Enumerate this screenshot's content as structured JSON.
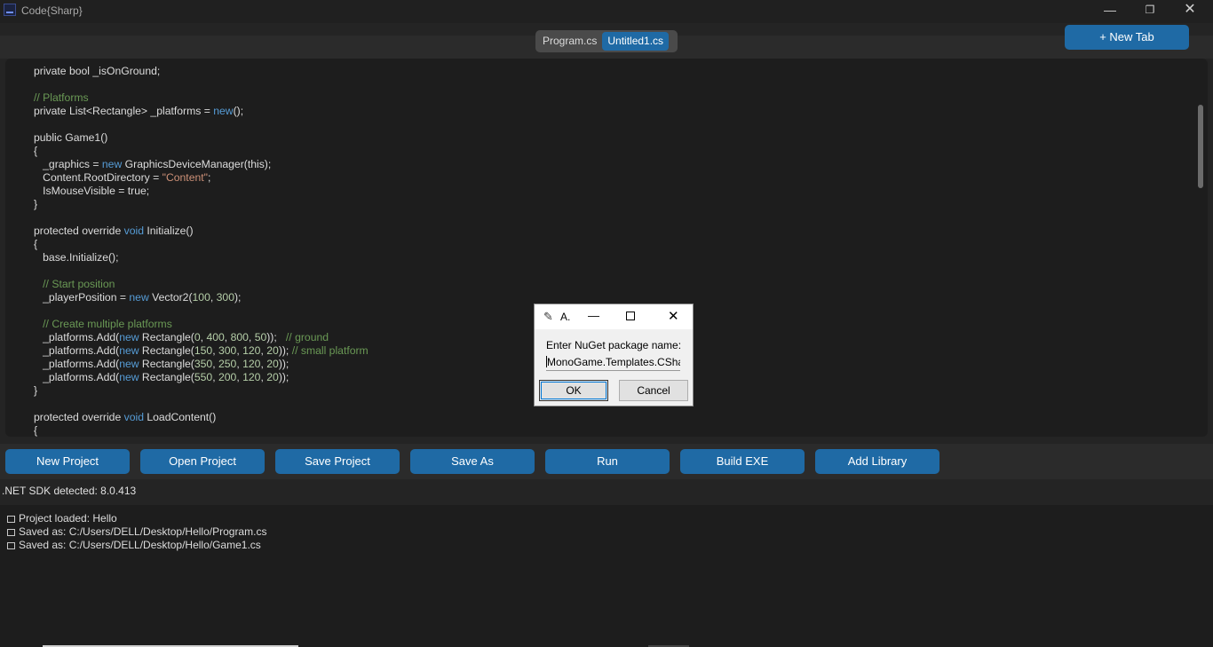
{
  "window": {
    "title": "Code{Sharp}",
    "min": "—",
    "max": "❐",
    "close": "✕"
  },
  "tabs": [
    {
      "label": "Program.cs"
    },
    {
      "label": "Untitled1.cs"
    }
  ],
  "new_tab_label": "+ New Tab",
  "editor_lines": [
    [
      [
        "private bool ",
        ""
      ],
      [
        "_isOnGround;",
        ""
      ]
    ],
    [],
    [
      [
        "// Platforms",
        "cm"
      ]
    ],
    [
      [
        "private ",
        ""
      ],
      [
        "List<Rectangle> _platforms = ",
        ""
      ],
      [
        "new",
        "kw"
      ],
      [
        "();",
        ""
      ]
    ],
    [],
    [
      [
        "public ",
        ""
      ],
      [
        "Game1()",
        ""
      ]
    ],
    [
      [
        "{",
        ""
      ]
    ],
    [
      [
        "   _graphics = ",
        ""
      ],
      [
        "new",
        "kw"
      ],
      [
        " GraphicsDeviceManager(this);",
        ""
      ]
    ],
    [
      [
        "   Content.RootDirectory = ",
        ""
      ],
      [
        "\"Content\"",
        "st"
      ],
      [
        ";",
        ""
      ]
    ],
    [
      [
        "   IsMouseVisible = true;",
        ""
      ]
    ],
    [
      [
        "}",
        ""
      ]
    ],
    [],
    [
      [
        "protected override ",
        ""
      ],
      [
        "void",
        "kw"
      ],
      [
        " Initialize()",
        ""
      ]
    ],
    [
      [
        "{",
        ""
      ]
    ],
    [
      [
        "   base.Initialize();",
        ""
      ]
    ],
    [],
    [
      [
        "   // Start position",
        "cm"
      ]
    ],
    [
      [
        "   _playerPosition = ",
        ""
      ],
      [
        "new",
        "kw"
      ],
      [
        " Vector2(",
        ""
      ],
      [
        "100",
        "nm"
      ],
      [
        ", ",
        ""
      ],
      [
        "300",
        "nm"
      ],
      [
        ");",
        ""
      ]
    ],
    [],
    [
      [
        "   // Create multiple platforms",
        "cm"
      ]
    ],
    [
      [
        "   _platforms.Add(",
        ""
      ],
      [
        "new",
        "kw"
      ],
      [
        " Rectangle(",
        ""
      ],
      [
        "0",
        "nm"
      ],
      [
        ", ",
        ""
      ],
      [
        "400",
        "nm"
      ],
      [
        ", ",
        ""
      ],
      [
        "800",
        "nm"
      ],
      [
        ", ",
        ""
      ],
      [
        "50",
        "nm"
      ],
      [
        "));   ",
        ""
      ],
      [
        "// ground",
        "cm"
      ]
    ],
    [
      [
        "   _platforms.Add(",
        ""
      ],
      [
        "new",
        "kw"
      ],
      [
        " Rectangle(",
        ""
      ],
      [
        "150",
        "nm"
      ],
      [
        ", ",
        ""
      ],
      [
        "300",
        "nm"
      ],
      [
        ", ",
        ""
      ],
      [
        "120",
        "nm"
      ],
      [
        ", ",
        ""
      ],
      [
        "20",
        "nm"
      ],
      [
        ")); ",
        ""
      ],
      [
        "// small platform",
        "cm"
      ]
    ],
    [
      [
        "   _platforms.Add(",
        ""
      ],
      [
        "new",
        "kw"
      ],
      [
        " Rectangle(",
        ""
      ],
      [
        "350",
        "nm"
      ],
      [
        ", ",
        ""
      ],
      [
        "250",
        "nm"
      ],
      [
        ", ",
        ""
      ],
      [
        "120",
        "nm"
      ],
      [
        ", ",
        ""
      ],
      [
        "20",
        "nm"
      ],
      [
        "));",
        ""
      ]
    ],
    [
      [
        "   _platforms.Add(",
        ""
      ],
      [
        "new",
        "kw"
      ],
      [
        " Rectangle(",
        ""
      ],
      [
        "550",
        "nm"
      ],
      [
        ", ",
        ""
      ],
      [
        "200",
        "nm"
      ],
      [
        ", ",
        ""
      ],
      [
        "120",
        "nm"
      ],
      [
        ", ",
        ""
      ],
      [
        "20",
        "nm"
      ],
      [
        "));",
        ""
      ]
    ],
    [
      [
        "}",
        ""
      ]
    ],
    [],
    [
      [
        "protected override ",
        ""
      ],
      [
        "void",
        "kw"
      ],
      [
        " LoadContent()",
        ""
      ]
    ],
    [
      [
        "{",
        ""
      ]
    ]
  ],
  "actions": {
    "new_project": "New Project",
    "open_project": "Open Project",
    "save_project": "Save Project",
    "save_as": "Save As",
    "run": "Run",
    "build_exe": "Build EXE",
    "add_library": "Add Library"
  },
  "sdk_status": ".NET SDK detected: 8.0.413",
  "log": [
    "Project loaded: Hello",
    "Saved as: C:/Users/DELL/Desktop/Hello/Program.cs",
    "Saved as: C:/Users/DELL/Desktop/Hello/Game1.cs"
  ],
  "dialog": {
    "title": "A.",
    "min": "—",
    "close": "✕",
    "prompt": "Enter NuGet package name:",
    "value": "MonoGame.Templates.CSha",
    "ok": "OK",
    "cancel": "Cancel"
  },
  "colors": {
    "accent": "#1f6aa5",
    "keyword": "#569cd6",
    "comment": "#6a9955",
    "string": "#ce9178",
    "number": "#b5cea8"
  }
}
